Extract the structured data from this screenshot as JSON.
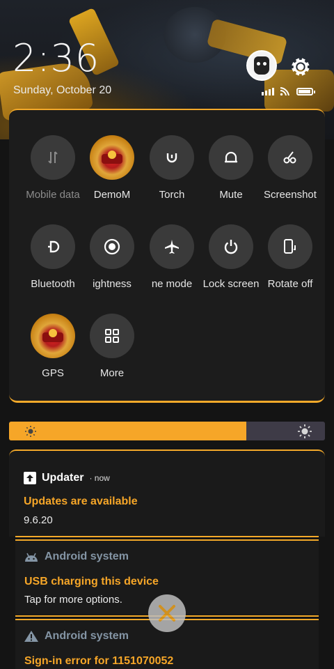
{
  "header": {
    "time": "2:36",
    "date": "Sunday, October 20",
    "avatar_icon": "robot-avatar-icon",
    "settings_icon": "gear-icon",
    "status_icons": [
      "signal-icon",
      "wifi-icon",
      "battery-icon"
    ]
  },
  "quick_settings": {
    "tiles": [
      {
        "label": "Mobile data",
        "icon": "mobile-data-icon",
        "active": false
      },
      {
        "label": "DemoM",
        "icon": "wifi-icon",
        "active": true
      },
      {
        "label": "Torch",
        "icon": "torch-icon",
        "active": false
      },
      {
        "label": "Mute",
        "icon": "bell-icon",
        "active": false
      },
      {
        "label": "Screenshot",
        "icon": "scissors-icon",
        "active": false
      },
      {
        "label": "Bluetooth",
        "icon": "bluetooth-icon",
        "active": false
      },
      {
        "label": "ightness",
        "icon": "auto-brightness-icon",
        "active": false
      },
      {
        "label": "ne mode",
        "icon": "airplane-icon",
        "active": false
      },
      {
        "label": "Lock screen",
        "icon": "power-icon",
        "active": false
      },
      {
        "label": "Rotate off",
        "icon": "rotate-icon",
        "active": false
      },
      {
        "label": "GPS",
        "icon": "location-icon",
        "active": true
      },
      {
        "label": "More",
        "icon": "grid-icon",
        "active": false
      }
    ]
  },
  "brightness": {
    "level": 0.75
  },
  "notifications": [
    {
      "app": "Updater",
      "when": "· now",
      "title": "Updates are available",
      "body": "9.6.20",
      "icon": "update-arrow-icon"
    },
    {
      "app": "Android system",
      "title": "USB charging this device",
      "body": "Tap for more options.",
      "icon": "android-icon"
    },
    {
      "app": "Android system",
      "title": "Sign-in error for 1151070052",
      "icon": "warning-icon"
    }
  ],
  "colors": {
    "accent": "#f6a628",
    "panel": "#1c1c1c",
    "tile": "#3a3a3a"
  }
}
